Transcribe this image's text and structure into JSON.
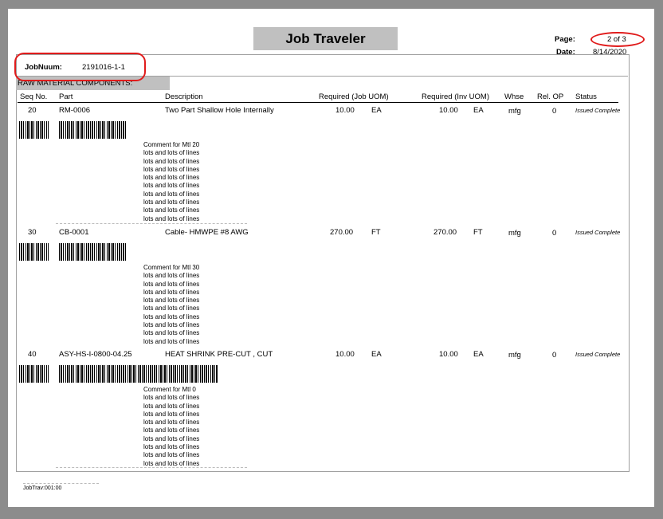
{
  "header": {
    "title": "Job Traveler",
    "page_label": "Page:",
    "page_value": "2 of 3",
    "date_label": "Date:",
    "date_value": "8/14/2020"
  },
  "job": {
    "label": "JobNuum:",
    "value": "2191016-1-1"
  },
  "section_title": "RAW MATERIAL COMPONENTS:",
  "columns": {
    "seq": "Seq No.",
    "part": "Part",
    "desc": "Description",
    "req_job": "Required (Job UOM)",
    "req_inv": "Required (Inv UOM)",
    "whse": "Whse",
    "relop": "Rel. OP",
    "status": "Status"
  },
  "rows": [
    {
      "seq": "20",
      "part": "RM-0006",
      "desc": "Two Part Shallow Hole Internally",
      "req_job": "10.00",
      "job_uom": "EA",
      "req_inv": "10.00",
      "inv_uom": "EA",
      "whse": "mfg",
      "relop": "0",
      "status": "Issued Complete",
      "comment_title": "Comment for Mtl 20"
    },
    {
      "seq": "30",
      "part": "CB-0001",
      "desc": "Cable- HMWPE #8 AWG",
      "req_job": "270.00",
      "job_uom": "FT",
      "req_inv": "270.00",
      "inv_uom": "FT",
      "whse": "mfg",
      "relop": "0",
      "status": "Issued Complete",
      "comment_title": "Comment for Mtl 30"
    },
    {
      "seq": "40",
      "part": "ASY-HS-I-0800-04.25",
      "desc": "HEAT SHRINK PRE-CUT , CUT",
      "req_job": "10.00",
      "job_uom": "EA",
      "req_inv": "10.00",
      "inv_uom": "EA",
      "whse": "mfg",
      "relop": "0",
      "status": "Issued Complete",
      "comment_title": "Comment for Mtl 0"
    }
  ],
  "comment_line": "lots and lots of lines",
  "footer": "JobTrav:001:00",
  "colors": {
    "annotation": "#e01b1b",
    "band": "#c0c0c0",
    "background": "#8c8c8c"
  }
}
